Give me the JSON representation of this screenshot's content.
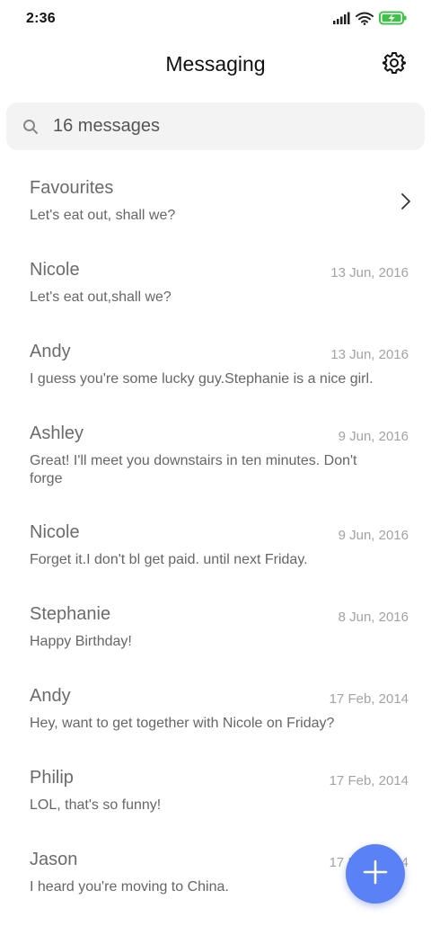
{
  "status_bar": {
    "time": "2:36"
  },
  "header": {
    "title": "Messaging"
  },
  "search": {
    "placeholder": "16 messages"
  },
  "conversations": [
    {
      "name": "Favourites",
      "date": "",
      "preview": "Let's eat out, shall we?"
    },
    {
      "name": "Nicole",
      "date": "13 Jun, 2016",
      "preview": "Let's eat out,shall we?"
    },
    {
      "name": "Andy",
      "date": "13 Jun, 2016",
      "preview": "I guess you're some lucky guy.Stephanie is a nice girl."
    },
    {
      "name": "Ashley",
      "date": "9 Jun, 2016",
      "preview": "Great! I'll meet you downstairs in ten minutes. Don't forge"
    },
    {
      "name": "Nicole",
      "date": "9 Jun, 2016",
      "preview": "Forget it.I don't bl get paid. until next Friday."
    },
    {
      "name": "Stephanie",
      "date": "8 Jun, 2016",
      "preview": "Happy Birthday!"
    },
    {
      "name": "Andy",
      "date": "17 Feb, 2014",
      "preview": "Hey, want to get together with Nicole on Friday?"
    },
    {
      "name": "Philip",
      "date": "17 Feb, 2014",
      "preview": "LOL, that's so funny!"
    },
    {
      "name": "Jason",
      "date": "17 Feb, 2014",
      "preview": "I heard you're moving to China."
    }
  ],
  "icons": {
    "signal": "signal-icon",
    "wifi": "wifi-icon",
    "battery": "battery-charging-icon",
    "settings": "gear-icon",
    "search": "search-icon",
    "chevron": "chevron-right-icon",
    "compose": "plus-icon"
  },
  "colors": {
    "accent": "#5b81f7",
    "battery": "#3fc24a",
    "search_bg": "#f3f3f3"
  }
}
